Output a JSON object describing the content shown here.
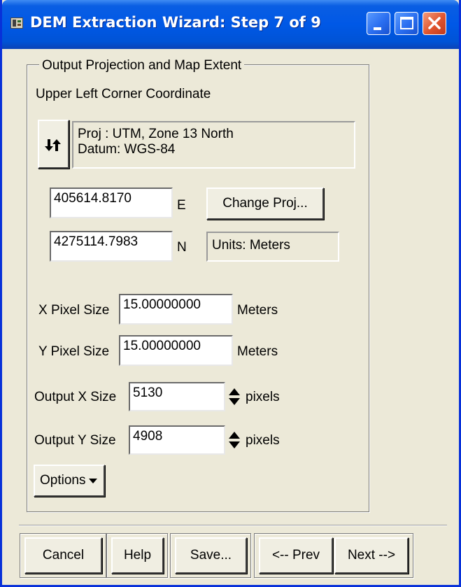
{
  "window": {
    "title": "DEM Extraction Wizard: Step 7 of 9",
    "controls": [
      "minimize-icon",
      "maximize-icon",
      "close-icon"
    ],
    "title_bar_color": "#0058e6",
    "face_color": "#ece9d8"
  },
  "group": {
    "legend": "Output Projection and Map Extent",
    "corner_label": "Upper Left Corner Coordinate",
    "swap_icon": "swap-arrows-icon",
    "proj_line": "Proj : UTM, Zone 13 North",
    "datum_line": "Datum: WGS-84",
    "easting": {
      "value": "405614.8170",
      "suffix": "E"
    },
    "northing": {
      "value": "4275114.7983",
      "suffix": "N"
    },
    "change_proj_label": "Change Proj...",
    "units_text": "Units: Meters",
    "x_pixel": {
      "label": "X Pixel Size",
      "value": "15.00000000",
      "unit": "Meters"
    },
    "y_pixel": {
      "label": "Y Pixel Size",
      "value": "15.00000000",
      "unit": "Meters"
    },
    "x_size": {
      "label": "Output X Size",
      "value": "5130",
      "unit": "pixels"
    },
    "y_size": {
      "label": "Output Y Size",
      "value": "4908",
      "unit": "pixels"
    },
    "options_label": "Options"
  },
  "footer": {
    "cancel_label": "Cancel",
    "help_label": "Help",
    "save_label": "Save...",
    "prev_label": "<-- Prev",
    "next_label": "Next -->"
  }
}
